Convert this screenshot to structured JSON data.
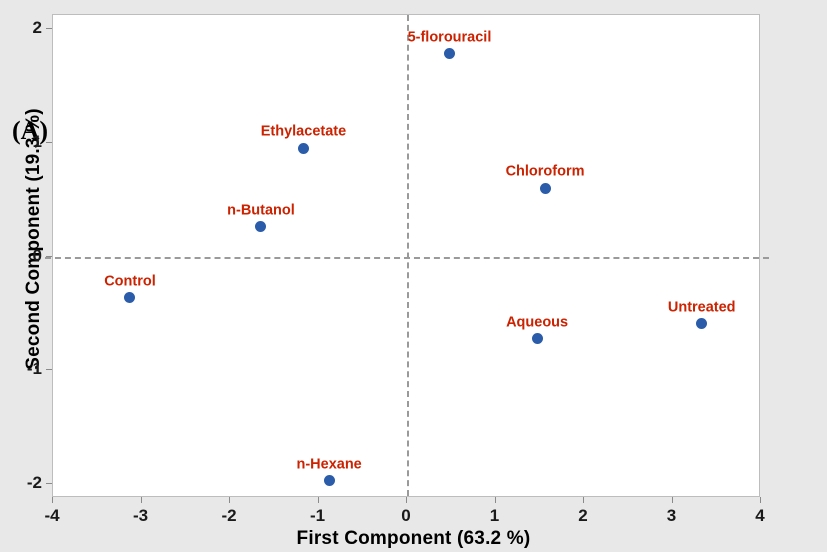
{
  "figure": {
    "panel_label": "(A)",
    "background_color": "#e8e8e8",
    "plot_background_color": "#ffffff"
  },
  "chart_data": {
    "type": "scatter",
    "title": "",
    "subtitle": "",
    "xlabel": "First Component (63.2 %)",
    "ylabel": "Second Component (19.3 %)",
    "xlim": [
      -4,
      4
    ],
    "ylim": [
      -2.12,
      2.12
    ],
    "xticks": [
      -4,
      -3,
      -2,
      -1,
      0,
      1,
      2,
      3,
      4
    ],
    "xtick_labels": [
      "-4",
      "-3",
      "-2",
      "-1",
      "0",
      "1",
      "2",
      "3",
      "4"
    ],
    "yticks": [
      -2,
      -1,
      0,
      1,
      2
    ],
    "ytick_labels": [
      "-2",
      "-1",
      "0",
      "1",
      "2"
    ],
    "grid": false,
    "legend": false,
    "reference_lines": {
      "vertical_x": 0,
      "horizontal_y": 0,
      "style": "dashed",
      "color": "#9a9a9a"
    },
    "marker_color": "#2a5caa",
    "label_color": "#cc2200",
    "points": [
      {
        "label": "5-florouracil",
        "x": 0.48,
        "y": 1.78
      },
      {
        "label": "Ethylacetate",
        "x": -1.17,
        "y": 0.95
      },
      {
        "label": "Chloroform",
        "x": 1.56,
        "y": 0.6
      },
      {
        "label": "n-Butanol",
        "x": -1.65,
        "y": 0.26
      },
      {
        "label": "Control",
        "x": -3.13,
        "y": -0.36
      },
      {
        "label": "Untreated",
        "x": 3.33,
        "y": -0.59
      },
      {
        "label": "Aqueous",
        "x": 1.47,
        "y": -0.72
      },
      {
        "label": "n-Hexane",
        "x": -0.88,
        "y": -1.97
      }
    ]
  }
}
